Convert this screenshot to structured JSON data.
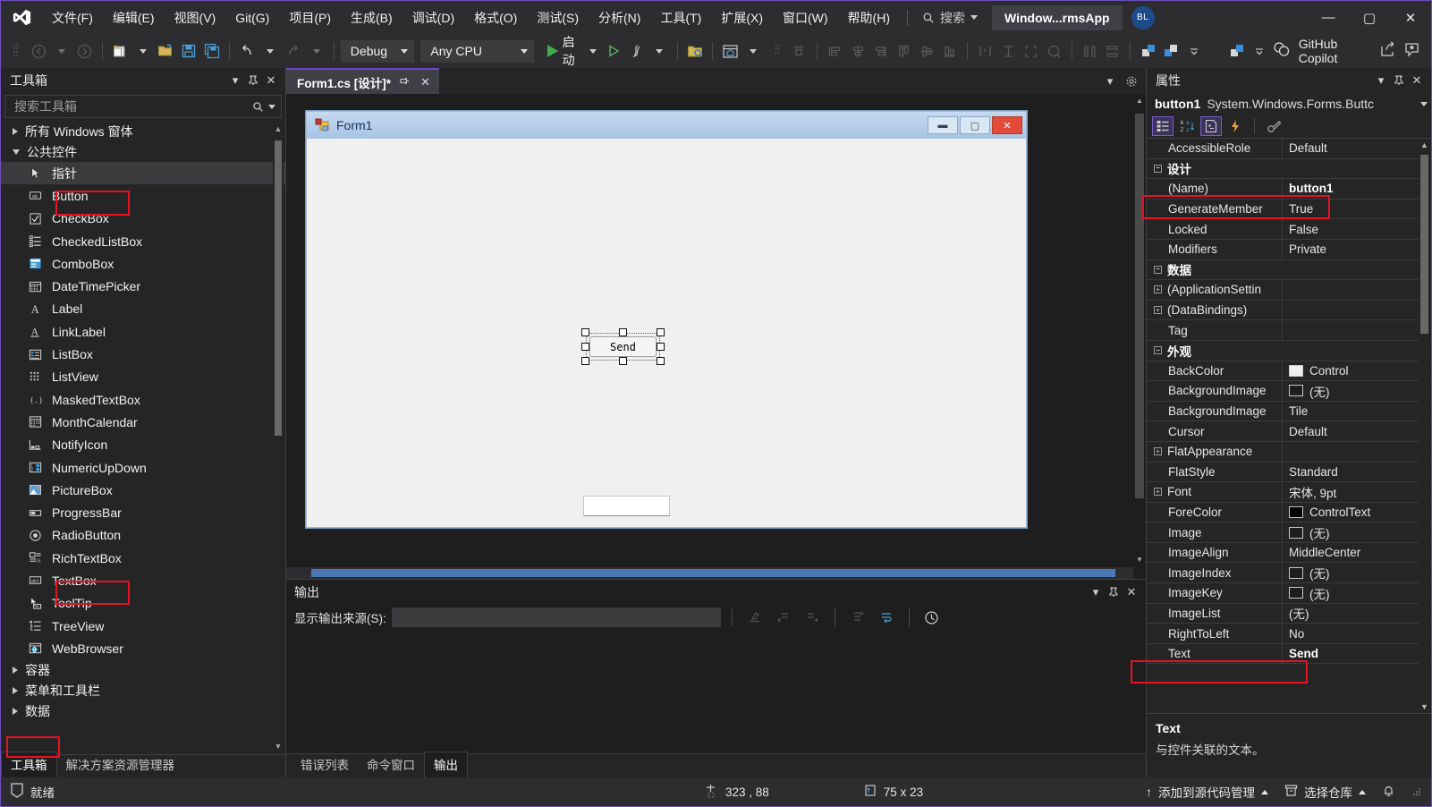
{
  "titlebar": {
    "logo_icon": "visual-studio-logo",
    "menus": [
      {
        "label": "文件(F)"
      },
      {
        "label": "编辑(E)"
      },
      {
        "label": "视图(V)"
      },
      {
        "label": "Git(G)"
      },
      {
        "label": "项目(P)"
      },
      {
        "label": "生成(B)"
      },
      {
        "label": "调试(D)"
      },
      {
        "label": "格式(O)"
      },
      {
        "label": "测试(S)"
      },
      {
        "label": "分析(N)"
      },
      {
        "label": "工具(T)"
      },
      {
        "label": "扩展(X)"
      },
      {
        "label": "窗口(W)"
      },
      {
        "label": "帮助(H)"
      }
    ],
    "search_label": "搜索",
    "project_chip": "Window...rmsApp",
    "avatar_initials": "BL",
    "minimize": "—",
    "maximize": "▢",
    "close": "✕"
  },
  "toolbar": {
    "config": "Debug",
    "platform": "Any CPU",
    "run_label": "启动",
    "copilot_label": "GitHub Copilot"
  },
  "toolbox": {
    "title": "工具箱",
    "search_placeholder": "搜索工具箱",
    "groups_top": [
      {
        "label": "所有 Windows 窗体",
        "expanded": false
      },
      {
        "label": "公共控件",
        "expanded": true
      }
    ],
    "items": [
      {
        "label": "指针",
        "icon": "pointer-icon",
        "selected": true,
        "highlight": false
      },
      {
        "label": "Button",
        "icon": "button-icon",
        "selected": false,
        "highlight": true
      },
      {
        "label": "CheckBox",
        "icon": "checkbox-icon",
        "selected": false,
        "highlight": false
      },
      {
        "label": "CheckedListBox",
        "icon": "checkedlistbox-icon",
        "selected": false,
        "highlight": false
      },
      {
        "label": "ComboBox",
        "icon": "combobox-icon",
        "selected": false,
        "highlight": false
      },
      {
        "label": "DateTimePicker",
        "icon": "datetimepicker-icon",
        "selected": false,
        "highlight": false
      },
      {
        "label": "Label",
        "icon": "label-icon",
        "selected": false,
        "highlight": false
      },
      {
        "label": "LinkLabel",
        "icon": "linklabel-icon",
        "selected": false,
        "highlight": false
      },
      {
        "label": "ListBox",
        "icon": "listbox-icon",
        "selected": false,
        "highlight": false
      },
      {
        "label": "ListView",
        "icon": "listview-icon",
        "selected": false,
        "highlight": false
      },
      {
        "label": "MaskedTextBox",
        "icon": "maskedtextbox-icon",
        "selected": false,
        "highlight": false
      },
      {
        "label": "MonthCalendar",
        "icon": "monthcalendar-icon",
        "selected": false,
        "highlight": false
      },
      {
        "label": "NotifyIcon",
        "icon": "notifyicon-icon",
        "selected": false,
        "highlight": false
      },
      {
        "label": "NumericUpDown",
        "icon": "numericupdown-icon",
        "selected": false,
        "highlight": false
      },
      {
        "label": "PictureBox",
        "icon": "picturebox-icon",
        "selected": false,
        "highlight": false
      },
      {
        "label": "ProgressBar",
        "icon": "progressbar-icon",
        "selected": false,
        "highlight": false
      },
      {
        "label": "RadioButton",
        "icon": "radiobutton-icon",
        "selected": false,
        "highlight": false
      },
      {
        "label": "RichTextBox",
        "icon": "richtextbox-icon",
        "selected": false,
        "highlight": false
      },
      {
        "label": "TextBox",
        "icon": "textbox-icon",
        "selected": false,
        "highlight": true
      },
      {
        "label": "ToolTip",
        "icon": "tooltip-icon",
        "selected": false,
        "highlight": false
      },
      {
        "label": "TreeView",
        "icon": "treeview-icon",
        "selected": false,
        "highlight": false
      },
      {
        "label": "WebBrowser",
        "icon": "webbrowser-icon",
        "selected": false,
        "highlight": false
      }
    ],
    "groups_bottom": [
      {
        "label": "容器"
      },
      {
        "label": "菜单和工具栏"
      },
      {
        "label": "数据"
      }
    ]
  },
  "left_dock_tabs": [
    {
      "label": "工具箱",
      "active": true,
      "highlight": true
    },
    {
      "label": "解决方案资源管理器",
      "active": false,
      "highlight": false
    }
  ],
  "designer": {
    "tab_label": "Form1.cs [设计]*",
    "form_title": "Form1",
    "minimize": "▬",
    "maximize": "▢",
    "close": "✕",
    "button": {
      "text": "Send",
      "width": "75",
      "height": "23"
    },
    "textbox": {
      "text": ""
    }
  },
  "output": {
    "title": "输出",
    "source_label": "显示输出来源(S):",
    "source_value": "",
    "tabs": [
      {
        "label": "错误列表",
        "active": false
      },
      {
        "label": "命令窗口",
        "active": false
      },
      {
        "label": "输出",
        "active": true
      }
    ]
  },
  "properties": {
    "title": "属性",
    "object_name": "button1",
    "object_type": "System.Windows.Forms.Buttc",
    "rows": [
      {
        "kind": "row",
        "key": "AccessibleRole",
        "value": "Default"
      },
      {
        "kind": "cat",
        "key": "设计",
        "sign": "−"
      },
      {
        "kind": "row",
        "key": "(Name)",
        "value": "button1",
        "bold": true,
        "highlight": true
      },
      {
        "kind": "row",
        "key": "GenerateMember",
        "value": "True"
      },
      {
        "kind": "row",
        "key": "Locked",
        "value": "False"
      },
      {
        "kind": "row",
        "key": "Modifiers",
        "value": "Private"
      },
      {
        "kind": "cat",
        "key": "数据",
        "sign": "−"
      },
      {
        "kind": "row",
        "key": "(ApplicationSettin",
        "value": "",
        "expander": "+"
      },
      {
        "kind": "row",
        "key": "(DataBindings)",
        "value": "",
        "expander": "+"
      },
      {
        "kind": "row",
        "key": "Tag",
        "value": ""
      },
      {
        "kind": "cat",
        "key": "外观",
        "sign": "−"
      },
      {
        "kind": "row",
        "key": "BackColor",
        "value": "Control",
        "swatch": "#f0f0f0"
      },
      {
        "kind": "row",
        "key": "BackgroundImage",
        "value": "(无)",
        "swatch": "#1e1e1e"
      },
      {
        "kind": "row",
        "key": "BackgroundImage",
        "value": "Tile"
      },
      {
        "kind": "row",
        "key": "Cursor",
        "value": "Default"
      },
      {
        "kind": "row",
        "key": "FlatAppearance",
        "value": "",
        "expander": "+"
      },
      {
        "kind": "row",
        "key": "FlatStyle",
        "value": "Standard"
      },
      {
        "kind": "row",
        "key": "Font",
        "value": "宋体, 9pt",
        "expander": "+"
      },
      {
        "kind": "row",
        "key": "ForeColor",
        "value": "ControlText",
        "swatch": "#000000"
      },
      {
        "kind": "row",
        "key": "Image",
        "value": "(无)",
        "swatch": "#1e1e1e"
      },
      {
        "kind": "row",
        "key": "ImageAlign",
        "value": "MiddleCenter"
      },
      {
        "kind": "row",
        "key": "ImageIndex",
        "value": "(无)",
        "swatch": "#1e1e1e"
      },
      {
        "kind": "row",
        "key": "ImageKey",
        "value": "(无)",
        "swatch": "#1e1e1e"
      },
      {
        "kind": "row",
        "key": "ImageList",
        "value": "(无)"
      },
      {
        "kind": "row",
        "key": "RightToLeft",
        "value": "No"
      },
      {
        "kind": "row",
        "key": "Text",
        "value": "Send",
        "bold": true,
        "highlight": true
      }
    ],
    "description": {
      "title": "Text",
      "text": "与控件关联的文本。"
    }
  },
  "statusbar": {
    "state": "就绪",
    "coordinates": "323 , 88",
    "size": "75 x 23",
    "source_control": "添加到源代码管理",
    "repo": "选择仓库"
  },
  "colors": {
    "accent_purple": "#6a46c8",
    "highlight_red": "#e81123",
    "chrome_dark": "#2d2d30",
    "panel_dark": "#252526",
    "editor_dark": "#1e1e1e",
    "run_green": "#3fae4a"
  }
}
